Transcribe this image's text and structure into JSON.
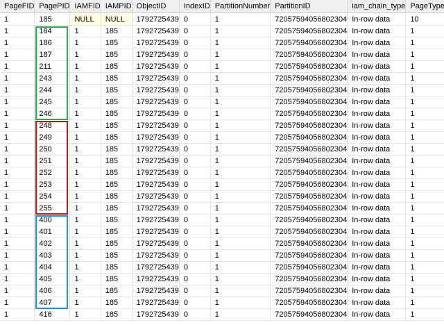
{
  "columns": [
    "PageFID",
    "PagePID",
    "IAMFID",
    "IAMPID",
    "ObjectID",
    "IndexID",
    "PartitionNumber",
    "PartitionID",
    "iam_chain_type",
    "PageType"
  ],
  "rows": [
    [
      "1",
      "185",
      "NULL",
      "NULL",
      "1792725439",
      "0",
      "1",
      "72057594056802304",
      "In-row data",
      "10"
    ],
    [
      "1",
      "184",
      "1",
      "185",
      "1792725439",
      "0",
      "1",
      "72057594056802304",
      "In-row data",
      "1"
    ],
    [
      "1",
      "186",
      "1",
      "185",
      "1792725439",
      "0",
      "1",
      "72057594056802304",
      "In-row data",
      "1"
    ],
    [
      "1",
      "187",
      "1",
      "185",
      "1792725439",
      "0",
      "1",
      "72057594056802304",
      "In-row data",
      "1"
    ],
    [
      "1",
      "211",
      "1",
      "185",
      "1792725439",
      "0",
      "1",
      "72057594056802304",
      "In-row data",
      "1"
    ],
    [
      "1",
      "243",
      "1",
      "185",
      "1792725439",
      "0",
      "1",
      "72057594056802304",
      "In-row data",
      "1"
    ],
    [
      "1",
      "244",
      "1",
      "185",
      "1792725439",
      "0",
      "1",
      "72057594056802304",
      "In-row data",
      "1"
    ],
    [
      "1",
      "245",
      "1",
      "185",
      "1792725439",
      "0",
      "1",
      "72057594056802304",
      "In-row data",
      "1"
    ],
    [
      "1",
      "246",
      "1",
      "185",
      "1792725439",
      "0",
      "1",
      "72057594056802304",
      "In-row data",
      "1"
    ],
    [
      "1",
      "248",
      "1",
      "185",
      "1792725439",
      "0",
      "1",
      "72057594056802304",
      "In-row data",
      "1"
    ],
    [
      "1",
      "249",
      "1",
      "185",
      "1792725439",
      "0",
      "1",
      "72057594056802304",
      "In-row data",
      "1"
    ],
    [
      "1",
      "250",
      "1",
      "185",
      "1792725439",
      "0",
      "1",
      "72057594056802304",
      "In-row data",
      "1"
    ],
    [
      "1",
      "251",
      "1",
      "185",
      "1792725439",
      "0",
      "1",
      "72057594056802304",
      "In-row data",
      "1"
    ],
    [
      "1",
      "252",
      "1",
      "185",
      "1792725439",
      "0",
      "1",
      "72057594056802304",
      "In-row data",
      "1"
    ],
    [
      "1",
      "253",
      "1",
      "185",
      "1792725439",
      "0",
      "1",
      "72057594056802304",
      "In-row data",
      "1"
    ],
    [
      "1",
      "254",
      "1",
      "185",
      "1792725439",
      "0",
      "1",
      "72057594056802304",
      "In-row data",
      "1"
    ],
    [
      "1",
      "255",
      "1",
      "185",
      "1792725439",
      "0",
      "1",
      "72057594056802304",
      "In-row data",
      "1"
    ],
    [
      "1",
      "400",
      "1",
      "185",
      "1792725439",
      "0",
      "1",
      "72057594056802304",
      "In-row data",
      "1"
    ],
    [
      "1",
      "401",
      "1",
      "185",
      "1792725439",
      "0",
      "1",
      "72057594056802304",
      "In-row data",
      "1"
    ],
    [
      "1",
      "402",
      "1",
      "185",
      "1792725439",
      "0",
      "1",
      "72057594056802304",
      "In-row data",
      "1"
    ],
    [
      "1",
      "403",
      "1",
      "185",
      "1792725439",
      "0",
      "1",
      "72057594056802304",
      "In-row data",
      "1"
    ],
    [
      "1",
      "404",
      "1",
      "185",
      "1792725439",
      "0",
      "1",
      "72057594056802304",
      "In-row data",
      "1"
    ],
    [
      "1",
      "405",
      "1",
      "185",
      "1792725439",
      "0",
      "1",
      "72057594056802304",
      "In-row data",
      "1"
    ],
    [
      "1",
      "406",
      "1",
      "185",
      "1792725439",
      "0",
      "1",
      "72057594056802304",
      "In-row data",
      "1"
    ],
    [
      "1",
      "407",
      "1",
      "185",
      "1792725439",
      "0",
      "1",
      "72057594056802304",
      "In-row data",
      "1"
    ],
    [
      "1",
      "416",
      "1",
      "185",
      "1792725439",
      "0",
      "1",
      "72057594056802304",
      "In-row data",
      "1"
    ]
  ],
  "null_cell_color": "#ffffe1",
  "highlights": [
    {
      "name": "green-highlight-box",
      "color": "#22b14c",
      "first_row": 1,
      "last_row": 8
    },
    {
      "name": "red-highlight-box",
      "color": "#d40f0f",
      "first_row": 9,
      "last_row": 16
    },
    {
      "name": "blue-highlight-box",
      "color": "#1e90e0",
      "first_row": 17,
      "last_row": 24
    }
  ]
}
